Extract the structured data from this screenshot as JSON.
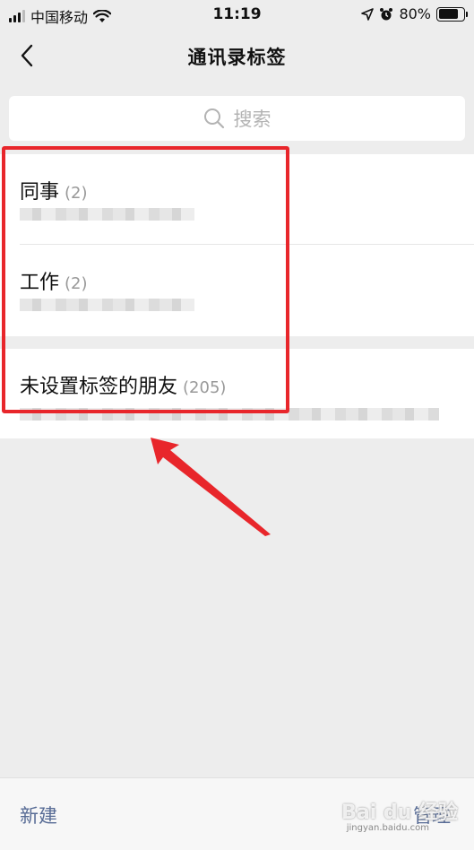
{
  "status_bar": {
    "carrier": "中国移动",
    "time": "11:19",
    "battery": "80%",
    "battery_level": 0.8
  },
  "nav": {
    "title": "通讯录标签"
  },
  "search": {
    "placeholder": "搜索"
  },
  "tags": [
    {
      "name": "同事",
      "count": "(2)"
    },
    {
      "name": "工作",
      "count": "(2)"
    }
  ],
  "untagged": {
    "name": "未设置标签的朋友",
    "count": "(205)"
  },
  "bottom": {
    "new_label": "新建",
    "manage_label": "管理",
    "watermark": "Bai du 经验",
    "watermark_sub": "jingyan.baidu.com"
  },
  "colors": {
    "highlight": "#e8262b",
    "link": "#576b95",
    "background": "#ededed"
  }
}
